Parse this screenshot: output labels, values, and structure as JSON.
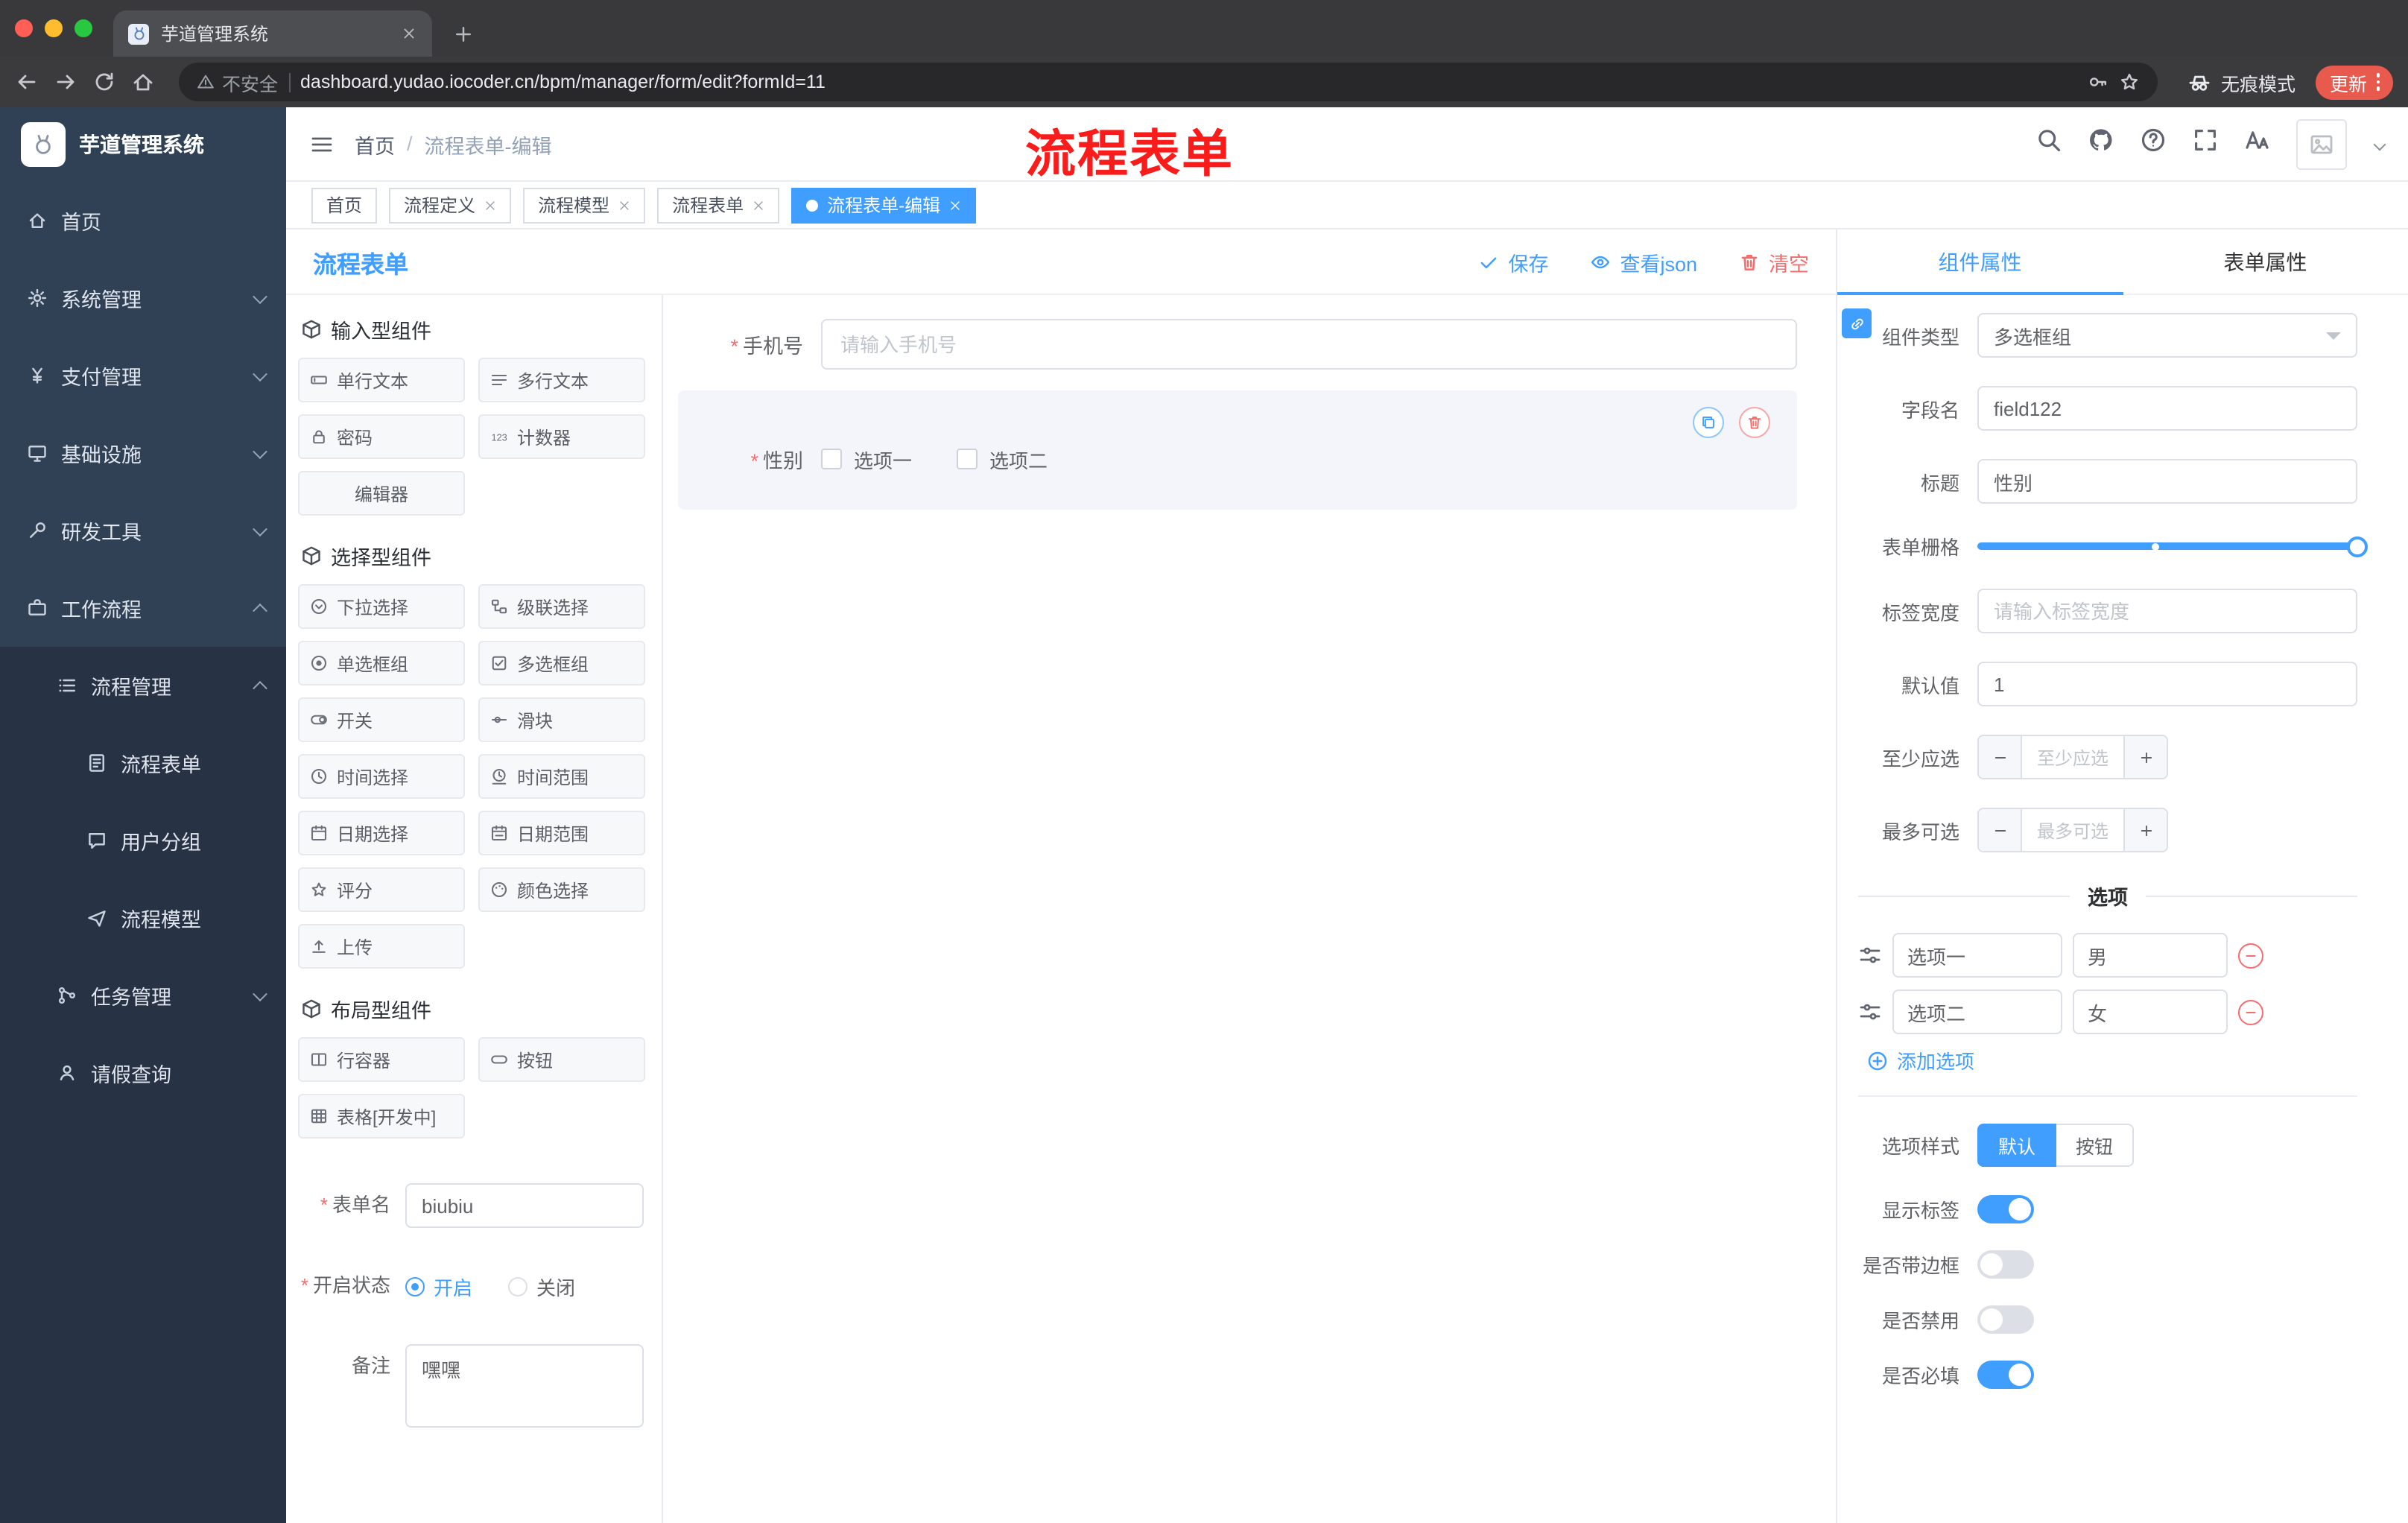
{
  "colors": {
    "primary": "#409eff",
    "danger": "#f56c6c",
    "sidebar_bg": "#304156"
  },
  "browser": {
    "tab_title": "芋道管理系统",
    "security_label": "不安全",
    "url": "dashboard.yudao.iocoder.cn/bpm/manager/form/edit?formId=11",
    "incognito_label": "无痕模式",
    "update_label": "更新"
  },
  "annotation": {
    "text": "流程表单"
  },
  "sidebar": {
    "logo_title": "芋道管理系统",
    "menu": [
      {
        "label": "首页",
        "icon": "home-icon"
      },
      {
        "label": "系统管理",
        "icon": "gear-icon"
      },
      {
        "label": "支付管理",
        "icon": "yen-icon"
      },
      {
        "label": "基础设施",
        "icon": "monitor-icon"
      },
      {
        "label": "研发工具",
        "icon": "wrench-icon"
      },
      {
        "label": "工作流程",
        "icon": "briefcase-icon"
      },
      {
        "label": "流程管理",
        "icon": "list-icon"
      },
      {
        "label": "流程表单",
        "icon": "document-icon"
      },
      {
        "label": "用户分组",
        "icon": "chat-icon"
      },
      {
        "label": "流程模型",
        "icon": "send-icon"
      },
      {
        "label": "任务管理",
        "icon": "branch-icon"
      },
      {
        "label": "请假查询",
        "icon": "user-icon"
      }
    ]
  },
  "header": {
    "breadcrumb": {
      "home": "首页",
      "separator": "/",
      "current": "流程表单-编辑"
    }
  },
  "tags": [
    {
      "label": "首页"
    },
    {
      "label": "流程定义"
    },
    {
      "label": "流程模型"
    },
    {
      "label": "流程表单"
    },
    {
      "label": "流程表单-编辑"
    }
  ],
  "designer": {
    "title": "流程表单",
    "actions": {
      "save": "保存",
      "view_json": "查看json",
      "clear": "清空"
    },
    "palette": {
      "sections": [
        {
          "title": "输入型组件",
          "items": [
            {
              "label": "单行文本",
              "icon": "single-line-icon"
            },
            {
              "label": "多行文本",
              "icon": "multi-line-icon"
            },
            {
              "label": "密码",
              "icon": "lock-icon"
            },
            {
              "label": "计数器",
              "icon": "counter-icon"
            },
            {
              "label": "编辑器",
              "icon": ""
            }
          ]
        },
        {
          "title": "选择型组件",
          "items": [
            {
              "label": "下拉选择",
              "icon": "dropdown-icon"
            },
            {
              "label": "级联选择",
              "icon": "cascade-icon"
            },
            {
              "label": "单选框组",
              "icon": "radio-icon"
            },
            {
              "label": "多选框组",
              "icon": "checkbox-icon"
            },
            {
              "label": "开关",
              "icon": "switch-icon"
            },
            {
              "label": "滑块",
              "icon": "slider-icon"
            },
            {
              "label": "时间选择",
              "icon": "time-icon"
            },
            {
              "label": "时间范围",
              "icon": "time-range-icon"
            },
            {
              "label": "日期选择",
              "icon": "date-icon"
            },
            {
              "label": "日期范围",
              "icon": "date-range-icon"
            },
            {
              "label": "评分",
              "icon": "star-icon"
            },
            {
              "label": "颜色选择",
              "icon": "color-icon"
            },
            {
              "label": "上传",
              "icon": "upload-icon"
            }
          ]
        },
        {
          "title": "布局型组件",
          "items": [
            {
              "label": "行容器",
              "icon": "row-container-icon"
            },
            {
              "label": "按钮",
              "icon": "button-icon"
            },
            {
              "label": "表格[开发中]",
              "icon": "table-icon"
            }
          ]
        }
      ]
    },
    "meta": {
      "form_name_label": "表单名",
      "form_name_value": "biubiu",
      "status_label": "开启状态",
      "status_on": "开启",
      "status_off": "关闭",
      "remark_label": "备注",
      "remark_value": "嘿嘿"
    },
    "canvas": {
      "phone_label": "手机号",
      "phone_placeholder": "请输入手机号",
      "gender_label": "性别",
      "gender_option1": "选项一",
      "gender_option2": "选项二"
    },
    "props": {
      "tab_component": "组件属性",
      "tab_form": "表单属性",
      "type_label": "组件类型",
      "type_value": "多选框组",
      "field_label": "字段名",
      "field_value": "field122",
      "title_label": "标题",
      "title_value": "性别",
      "grid_label": "表单栅格",
      "label_width_label": "标签宽度",
      "label_width_placeholder": "请输入标签宽度",
      "default_label": "默认值",
      "default_value": "1",
      "min_label": "至少应选",
      "min_placeholder": "至少应选",
      "max_label": "最多可选",
      "max_placeholder": "最多可选",
      "options_divider": "选项",
      "options": [
        {
          "name": "选项一",
          "value": "男"
        },
        {
          "name": "选项二",
          "value": "女"
        }
      ],
      "add_option": "添加选项",
      "style_label": "选项样式",
      "style_default": "默认",
      "style_button": "按钮",
      "switches": [
        {
          "label": "显示标签",
          "on": true
        },
        {
          "label": "是否带边框",
          "on": false
        },
        {
          "label": "是否禁用",
          "on": false
        },
        {
          "label": "是否必填",
          "on": true
        }
      ]
    }
  }
}
